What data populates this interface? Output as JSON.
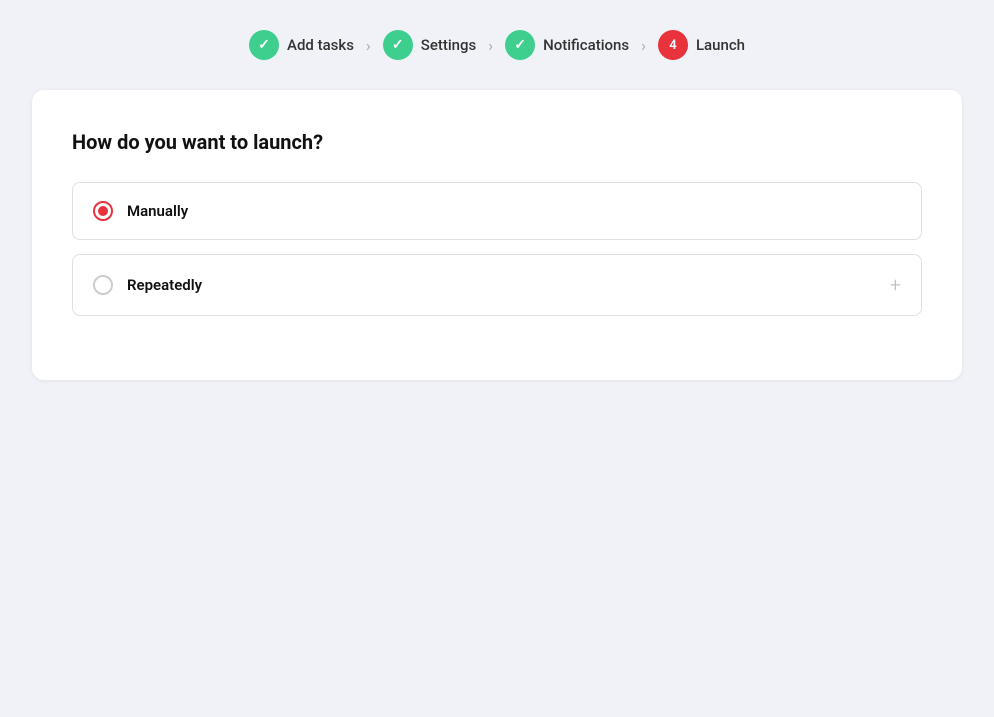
{
  "stepper": {
    "steps": [
      {
        "id": "add-tasks",
        "label": "Add tasks",
        "state": "completed",
        "number": null
      },
      {
        "id": "settings",
        "label": "Settings",
        "state": "completed",
        "number": null
      },
      {
        "id": "notifications",
        "label": "Notifications",
        "state": "completed",
        "number": null
      },
      {
        "id": "launch",
        "label": "Launch",
        "state": "active",
        "number": "4"
      }
    ]
  },
  "card": {
    "title": "How do you want to launch?",
    "options": [
      {
        "id": "manually",
        "label": "Manually",
        "selected": true
      },
      {
        "id": "repeatedly",
        "label": "Repeatedly",
        "selected": false
      }
    ]
  },
  "colors": {
    "completed": "#3ecf8e",
    "active": "#e8323c",
    "radio_checked": "#e8323c"
  }
}
